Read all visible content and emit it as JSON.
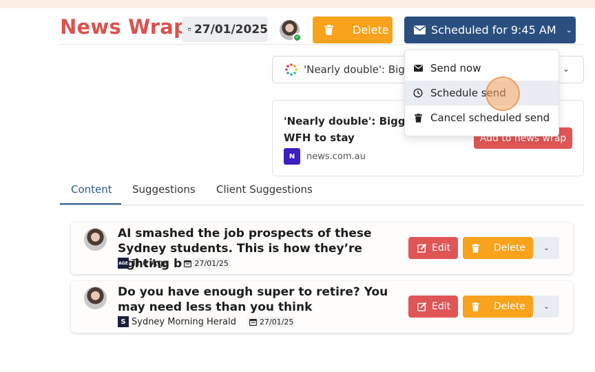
{
  "header": {
    "title": "News Wrap",
    "date": "27/01/2025",
    "delete_label": "Delete",
    "schedule_label": "Scheduled for 9:45 AM"
  },
  "selector": {
    "value": "'Nearly double': Bigg"
  },
  "preview": {
    "title": "'Nearly double': Biggest yet WFH to stay",
    "source_logo": "N",
    "source": "news.com.au",
    "add_label": "Add to news wrap"
  },
  "menu": {
    "items": [
      {
        "label": "Send now",
        "icon": "envelope-icon"
      },
      {
        "label": "Schedule send",
        "icon": "clock-icon",
        "highlighted": true
      },
      {
        "label": "Cancel scheduled send",
        "icon": "trash-icon"
      }
    ]
  },
  "tabs": [
    {
      "label": "Content",
      "active": true
    },
    {
      "label": "Suggestions",
      "active": false
    },
    {
      "label": "Client Suggestions",
      "active": false
    }
  ],
  "articles": [
    {
      "title": "AI smashed the job prospects of these Sydney students. This is how they’re fighting back",
      "source_logo": "AGE",
      "source": "The Age",
      "date": "27/01/25",
      "edit_label": "Edit",
      "delete_label": "Delete"
    },
    {
      "title": "Do you have enough super to retire? You may need less than you think",
      "source_logo": "S",
      "source": "Sydney Morning Herald",
      "date": "27/01/25",
      "edit_label": "Edit",
      "delete_label": "Delete"
    }
  ],
  "colors": {
    "brand_red": "#d9534f",
    "delete_orange": "#f9a21b",
    "schedule_navy": "#2a4f7f",
    "edit_red": "#e05555",
    "tab_active": "#2a5a8a"
  }
}
